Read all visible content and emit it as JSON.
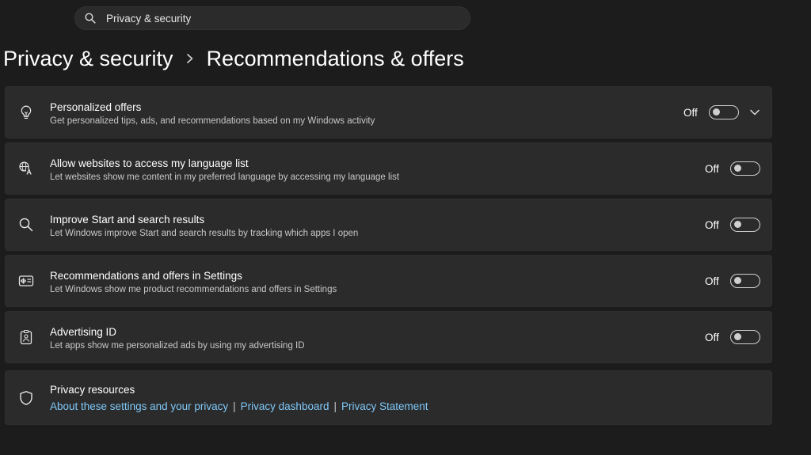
{
  "search": {
    "value": "Privacy & security",
    "icon": "search-icon"
  },
  "breadcrumb": {
    "parent": "Privacy & security",
    "current": "Recommendations & offers"
  },
  "settings": [
    {
      "icon": "lightbulb-icon",
      "title": "Personalized offers",
      "description": "Get personalized tips, ads, and recommendations based on my Windows activity",
      "state": "Off",
      "expandable": true
    },
    {
      "icon": "language-icon",
      "title": "Allow websites to access my language list",
      "description": "Let websites show me content in my preferred language by accessing my language list",
      "state": "Off"
    },
    {
      "icon": "search-icon",
      "title": "Improve Start and search results",
      "description": "Let Windows improve Start and search results by tracking which apps I open",
      "state": "Off"
    },
    {
      "icon": "settings-recommendations-icon",
      "title": "Recommendations and offers in Settings",
      "description": "Let Windows show me product recommendations and offers in Settings",
      "state": "Off"
    },
    {
      "icon": "advertising-id-icon",
      "title": "Advertising ID",
      "description": "Let apps show me personalized ads by using my advertising ID",
      "state": "Off"
    }
  ],
  "resources": {
    "icon": "shield-icon",
    "title": "Privacy resources",
    "links": [
      "About these settings and your privacy",
      "Privacy dashboard",
      "Privacy Statement"
    ]
  },
  "colors": {
    "background": "#1c1c1c",
    "card": "#2b2b2b",
    "link": "#7fc8f8"
  }
}
